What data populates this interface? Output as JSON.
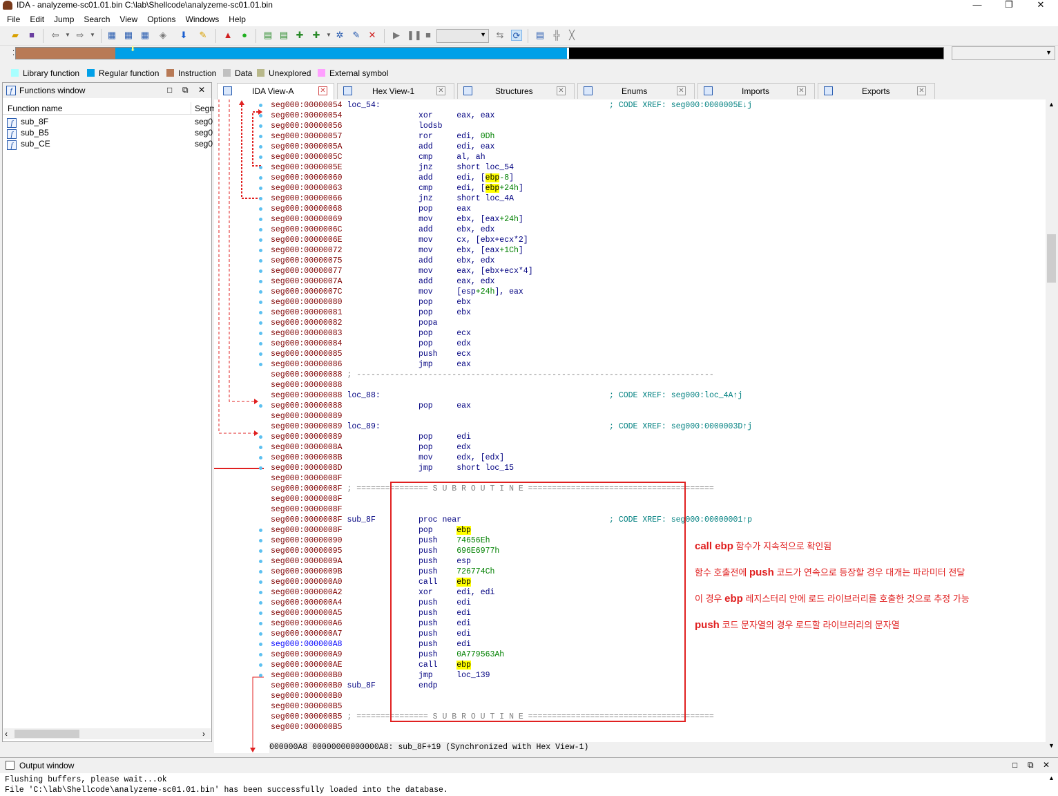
{
  "window": {
    "title": "IDA - analyzeme-sc01.01.bin C:\\lab\\Shellcode\\analyzeme-sc01.01.bin",
    "minimize": "—",
    "restore": "❐",
    "close": "✕"
  },
  "menu": [
    "File",
    "Edit",
    "Jump",
    "Search",
    "View",
    "Options",
    "Windows",
    "Help"
  ],
  "navbar_colors": {
    "library": "#a8ffff",
    "regular": "#00a0e8",
    "instruction": "#b87a56",
    "data": "#c0c0c0",
    "unexplored": "#b8b88a",
    "external": "#ffa0ff",
    "black": "#000000"
  },
  "legend": [
    {
      "label": "Library function",
      "color": "#a8ffff"
    },
    {
      "label": "Regular function",
      "color": "#00a0e8"
    },
    {
      "label": "Instruction",
      "color": "#b87a56"
    },
    {
      "label": "Data",
      "color": "#c0c0c0"
    },
    {
      "label": "Unexplored",
      "color": "#b8b88a"
    },
    {
      "label": "External symbol",
      "color": "#ffa0ff"
    }
  ],
  "functions_window": {
    "title": "Functions window",
    "columns": [
      "Function name",
      "Segm"
    ],
    "rows": [
      {
        "name": "sub_8F",
        "seg": "seg0"
      },
      {
        "name": "sub_B5",
        "seg": "seg0"
      },
      {
        "name": "sub_CE",
        "seg": "seg0"
      }
    ]
  },
  "tabs": [
    {
      "label": "IDA View-A",
      "active": true
    },
    {
      "label": "Hex View-1",
      "active": false
    },
    {
      "label": "Structures",
      "active": false
    },
    {
      "label": "Enums",
      "active": false
    },
    {
      "label": "Imports",
      "active": false
    },
    {
      "label": "Exports",
      "active": false
    }
  ],
  "code": [
    {
      "a": "seg000:00000054",
      "l": "loc_54:",
      "m": "",
      "o": "",
      "c": "; CODE XREF: seg000:0000005E↓j"
    },
    {
      "a": "seg000:00000054",
      "l": "",
      "m": "xor",
      "o": "eax, eax"
    },
    {
      "a": "seg000:00000056",
      "l": "",
      "m": "lodsb",
      "o": ""
    },
    {
      "a": "seg000:00000057",
      "l": "",
      "m": "ror",
      "o": "edi, |0Dh|"
    },
    {
      "a": "seg000:0000005A",
      "l": "",
      "m": "add",
      "o": "edi, eax"
    },
    {
      "a": "seg000:0000005C",
      "l": "",
      "m": "cmp",
      "o": "al, ah"
    },
    {
      "a": "seg000:0000005E",
      "l": "",
      "m": "jnz",
      "o": "short loc_54"
    },
    {
      "a": "seg000:00000060",
      "l": "",
      "m": "add",
      "o": "edi, [^ebp^|-8|]"
    },
    {
      "a": "seg000:00000063",
      "l": "",
      "m": "cmp",
      "o": "edi, [^ebp^|+24h|]"
    },
    {
      "a": "seg000:00000066",
      "l": "",
      "m": "jnz",
      "o": "short loc_4A"
    },
    {
      "a": "seg000:00000068",
      "l": "",
      "m": "pop",
      "o": "eax"
    },
    {
      "a": "seg000:00000069",
      "l": "",
      "m": "mov",
      "o": "ebx, [eax|+24h|]"
    },
    {
      "a": "seg000:0000006C",
      "l": "",
      "m": "add",
      "o": "ebx, edx"
    },
    {
      "a": "seg000:0000006E",
      "l": "",
      "m": "mov",
      "o": "cx, [ebx+ecx*2]"
    },
    {
      "a": "seg000:00000072",
      "l": "",
      "m": "mov",
      "o": "ebx, [eax|+1Ch|]"
    },
    {
      "a": "seg000:00000075",
      "l": "",
      "m": "add",
      "o": "ebx, edx"
    },
    {
      "a": "seg000:00000077",
      "l": "",
      "m": "mov",
      "o": "eax, [ebx+ecx*4]"
    },
    {
      "a": "seg000:0000007A",
      "l": "",
      "m": "add",
      "o": "eax, edx"
    },
    {
      "a": "seg000:0000007C",
      "l": "",
      "m": "mov",
      "o": "[esp|+24h|], eax"
    },
    {
      "a": "seg000:00000080",
      "l": "",
      "m": "pop",
      "o": "ebx"
    },
    {
      "a": "seg000:00000081",
      "l": "",
      "m": "pop",
      "o": "ebx"
    },
    {
      "a": "seg000:00000082",
      "l": "",
      "m": "popa",
      "o": ""
    },
    {
      "a": "seg000:00000083",
      "l": "",
      "m": "pop",
      "o": "ecx"
    },
    {
      "a": "seg000:00000084",
      "l": "",
      "m": "pop",
      "o": "edx"
    },
    {
      "a": "seg000:00000085",
      "l": "",
      "m": "push",
      "o": "ecx"
    },
    {
      "a": "seg000:00000086",
      "l": "",
      "m": "jmp",
      "o": "eax"
    },
    {
      "a": "seg000:00000088",
      "l": "",
      "sep": "; ---------------------------------------------------------------------------"
    },
    {
      "a": "seg000:00000088",
      "l": ""
    },
    {
      "a": "seg000:00000088",
      "l": "loc_88:",
      "m": "",
      "o": "",
      "c": "; CODE XREF: seg000:loc_4A↑j"
    },
    {
      "a": "seg000:00000088",
      "l": "",
      "m": "pop",
      "o": "eax"
    },
    {
      "a": "seg000:00000089",
      "l": ""
    },
    {
      "a": "seg000:00000089",
      "l": "loc_89:",
      "m": "",
      "o": "",
      "c": "; CODE XREF: seg000:0000003D↑j"
    },
    {
      "a": "seg000:00000089",
      "l": "",
      "m": "pop",
      "o": "edi"
    },
    {
      "a": "seg000:0000008A",
      "l": "",
      "m": "pop",
      "o": "edx"
    },
    {
      "a": "seg000:0000008B",
      "l": "",
      "m": "mov",
      "o": "edx, [edx]"
    },
    {
      "a": "seg000:0000008D",
      "l": "",
      "m": "jmp",
      "o": "short loc_15"
    },
    {
      "a": "seg000:0000008F",
      "l": ""
    },
    {
      "a": "seg000:0000008F",
      "l": "",
      "sep": "; =============== S U B R O U T I N E ======================================="
    },
    {
      "a": "seg000:0000008F",
      "l": ""
    },
    {
      "a": "seg000:0000008F",
      "l": ""
    },
    {
      "a": "seg000:0000008F",
      "l": "sub_8F",
      "m": "proc near",
      "o": "",
      "c": "; CODE XREF: seg000:00000001↑p"
    },
    {
      "a": "seg000:0000008F",
      "l": "",
      "m": "pop",
      "o": "^ebp^"
    },
    {
      "a": "seg000:00000090",
      "l": "",
      "m": "push",
      "o": "|74656Eh|"
    },
    {
      "a": "seg000:00000095",
      "l": "",
      "m": "push",
      "o": "|696E6977h|"
    },
    {
      "a": "seg000:0000009A",
      "l": "",
      "m": "push",
      "o": "esp"
    },
    {
      "a": "seg000:0000009B",
      "l": "",
      "m": "push",
      "o": "|726774Ch|"
    },
    {
      "a": "seg000:000000A0",
      "l": "",
      "m": "call",
      "o": "^ebp^"
    },
    {
      "a": "seg000:000000A2",
      "l": "",
      "m": "xor",
      "o": "edi, edi"
    },
    {
      "a": "seg000:000000A4",
      "l": "",
      "m": "push",
      "o": "edi"
    },
    {
      "a": "seg000:000000A5",
      "l": "",
      "m": "push",
      "o": "edi"
    },
    {
      "a": "seg000:000000A6",
      "l": "",
      "m": "push",
      "o": "edi"
    },
    {
      "a": "seg000:000000A7",
      "l": "",
      "m": "push",
      "o": "edi"
    },
    {
      "a": "seg000:000000A8",
      "l": "",
      "m": "push",
      "o": "edi",
      "cur": true
    },
    {
      "a": "seg000:000000A9",
      "l": "",
      "m": "push",
      "o": "|0A779563Ah|"
    },
    {
      "a": "seg000:000000AE",
      "l": "",
      "m": "call",
      "o": "^ebp^"
    },
    {
      "a": "seg000:000000B0",
      "l": "",
      "m": "jmp",
      "o": "loc_139"
    },
    {
      "a": "seg000:000000B0",
      "l": "sub_8F",
      "m": "endp",
      "o": ""
    },
    {
      "a": "seg000:000000B0",
      "l": ""
    },
    {
      "a": "seg000:000000B5",
      "l": ""
    },
    {
      "a": "seg000:000000B5",
      "l": "",
      "sep": "; =============== S U B R O U T I N E ======================================="
    },
    {
      "a": "seg000:000000B5",
      "l": ""
    }
  ],
  "status_line": "000000A8 00000000000000A8: sub_8F+19 (Synchronized with Hex View-1)",
  "annotations": [
    {
      "bold": "call ebp",
      "text": " 함수가 지속적으로 확인됨"
    },
    {
      "pre": "함수 호출전에 ",
      "bold": "push",
      "text": " 코드가 연속으로 등장할 경우 대개는 파라미터 전달"
    },
    {
      "pre": "이 경우 ",
      "bold": "ebp",
      "text": " 레지스터리 안에 로드 라이브러리를 호출한 것으로 추정 가능"
    },
    {
      "bold": "push",
      "text": " 코드 문자열의 경우 로드할 라이브러리의 문자열"
    }
  ],
  "output_window": {
    "title": "Output window",
    "lines": [
      "Flushing buffers, please wait...ok",
      "File 'C:\\lab\\Shellcode\\analyzeme-sc01.01.bin' has been successfully loaded into the database."
    ]
  },
  "icons": {
    "close": "✕",
    "pin": "⧉",
    "box": "□",
    "chevron_left": "‹",
    "chevron_right": "›",
    "up": "▲",
    "down": "▼"
  }
}
